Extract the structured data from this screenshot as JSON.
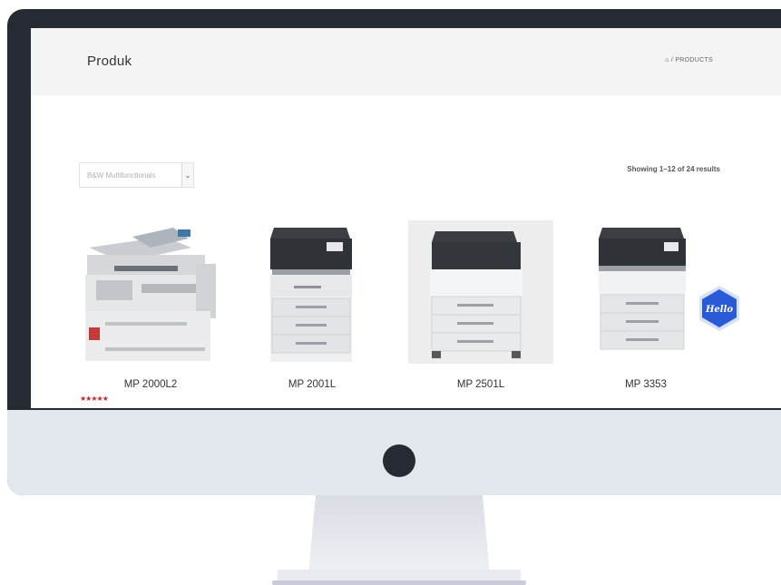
{
  "page": {
    "title": "Produk",
    "breadcrumb_icon": "home-icon",
    "breadcrumb_text": "/ PRODUCTS"
  },
  "filter": {
    "selected": "B&W Multifunctionals",
    "arrow_icon": "chevron-down-icon"
  },
  "results": {
    "summary": "Showing 1–12 of 24 results"
  },
  "products": [
    {
      "name": "MP 2000L2",
      "rating_stars": 5,
      "rating_text": "★★★★★"
    },
    {
      "name": "MP 2001L"
    },
    {
      "name": "MP 2501L"
    },
    {
      "name": "MP 3353"
    }
  ],
  "chat_widget": {
    "label": "Hello",
    "color": "#2a5bd7"
  },
  "colors": {
    "monitor_bezel": "#262a33",
    "monitor_chin": "#e3e7ee",
    "header_bg": "#f4f4f4",
    "rating_red": "#c0272d"
  }
}
